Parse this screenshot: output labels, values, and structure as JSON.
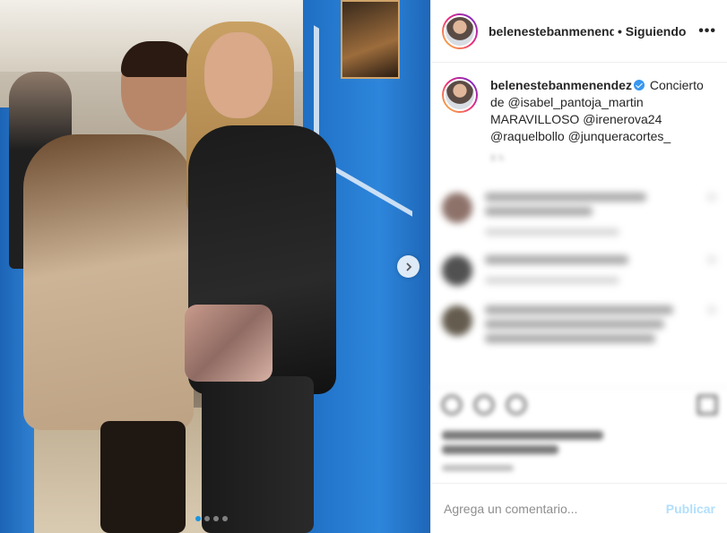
{
  "header": {
    "username": "belenestebanmenendez",
    "separator": "•",
    "follow_status": "Siguiendo",
    "more": "•••"
  },
  "caption": {
    "username": "belenestebanmenendez",
    "text_line1": "Concierto",
    "text_line2": "de @isabel_pantoja_martin",
    "text_line3": "MARAVILLOSO @irenerova24",
    "text_line4": "@raquelbollo @junqueracortes_",
    "time": "8 h"
  },
  "add_comment": {
    "placeholder": "Agrega un comentario...",
    "publish_label": "Publicar"
  },
  "carousel": {
    "dots": 4,
    "active_index": 0
  },
  "colors": {
    "accent": "#3897f0",
    "publish_disabled": "#b2dffc",
    "text": "#262626"
  }
}
